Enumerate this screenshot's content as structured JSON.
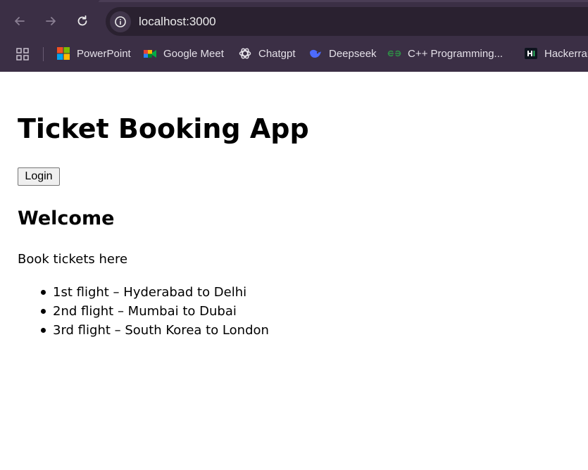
{
  "browser": {
    "url": "localhost:3000",
    "nav": {
      "back_icon": "arrow-left-icon",
      "forward_icon": "arrow-right-icon",
      "reload_icon": "reload-icon"
    },
    "bookmarks": [
      {
        "label": "PowerPoint",
        "icon": "powerpoint-icon"
      },
      {
        "label": "Google Meet",
        "icon": "google-meet-icon"
      },
      {
        "label": "Chatgpt",
        "icon": "chatgpt-icon"
      },
      {
        "label": "Deepseek",
        "icon": "deepseek-icon"
      },
      {
        "label": "C++ Programming...",
        "icon": "geeksforgeeks-icon"
      },
      {
        "label": "Hackerrank",
        "icon": "hackerrank-icon"
      }
    ],
    "colors": {
      "chrome_bg": "#3b2f45",
      "omnibox_bg": "#2a2130"
    }
  },
  "page": {
    "title": "Ticket Booking App",
    "login_label": "Login",
    "welcome_heading": "Welcome",
    "intro_text": "Book tickets here",
    "flights": [
      "1st flight – Hyderabad to Delhi",
      "2nd flight – Mumbai to Dubai",
      "3rd flight – South Korea to London"
    ]
  }
}
